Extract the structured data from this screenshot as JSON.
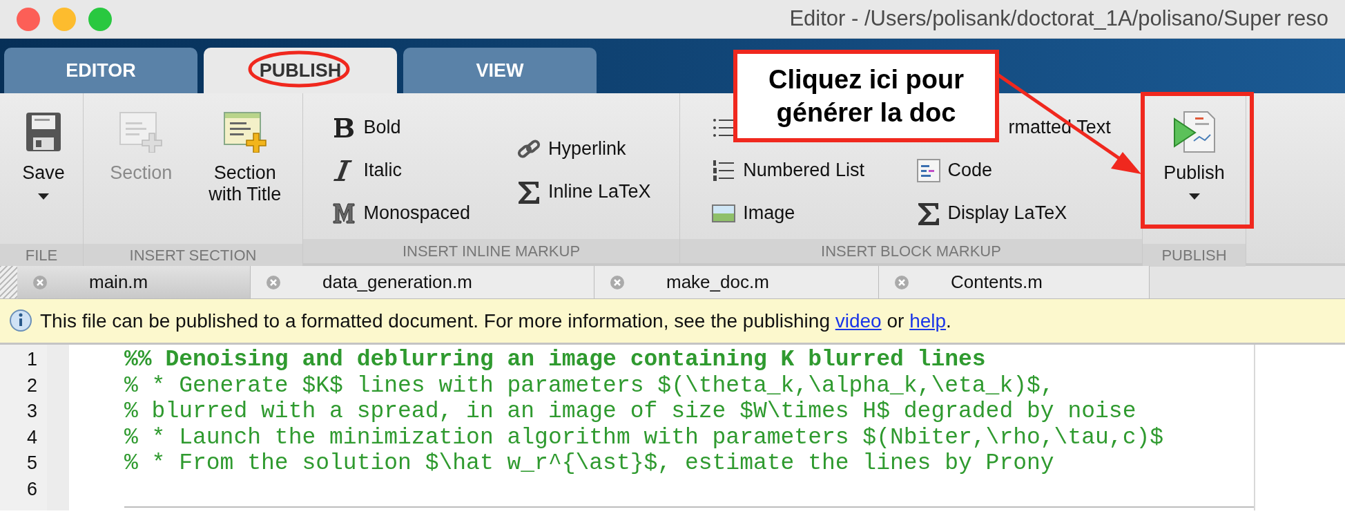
{
  "window": {
    "title": "Editor - /Users/polisank/doctorat_1A/polisano/Super reso"
  },
  "tabs": [
    {
      "label": "EDITOR",
      "selected": false
    },
    {
      "label": "PUBLISH",
      "selected": true
    },
    {
      "label": "VIEW",
      "selected": false
    }
  ],
  "ribbon": {
    "groups": [
      {
        "label": "FILE",
        "columns": [
          [
            {
              "kind": "large",
              "label": "Save",
              "dropdown": true,
              "disabled": false
            }
          ]
        ]
      },
      {
        "label": "INSERT SECTION",
        "columns": [
          [
            {
              "kind": "large",
              "label": "Section",
              "dropdown": false,
              "disabled": true
            }
          ],
          [
            {
              "kind": "large",
              "label": "Section with Title",
              "dropdown": false,
              "disabled": false
            }
          ]
        ]
      },
      {
        "label": "INSERT INLINE MARKUP",
        "columns": [
          [
            {
              "kind": "small",
              "label": "Bold"
            },
            {
              "kind": "small",
              "label": "Italic"
            },
            {
              "kind": "small",
              "label": "Monospaced"
            }
          ],
          [
            {
              "kind": "small",
              "label": "Hyperlink"
            },
            {
              "kind": "small",
              "label": "Inline LaTeX"
            }
          ]
        ]
      },
      {
        "label": "INSERT BLOCK MARKUP",
        "columns": [
          [
            {
              "kind": "small"
            },
            {
              "kind": "small",
              "label": "Numbered List"
            },
            {
              "kind": "small",
              "label": "Image"
            }
          ],
          [
            {
              "kind": "small",
              "label": "rmatted Text"
            },
            {
              "kind": "small",
              "label": "Code"
            },
            {
              "kind": "small",
              "label": "Display LaTeX"
            }
          ]
        ]
      },
      {
        "label": "PUBLISH",
        "columns": [
          [
            {
              "kind": "large",
              "label": "Publish",
              "dropdown": true,
              "disabled": false
            }
          ]
        ]
      }
    ]
  },
  "file_tabs": [
    {
      "label": "main.m",
      "selected": true
    },
    {
      "label": "data_generation.m",
      "selected": false
    },
    {
      "label": "make_doc.m",
      "selected": false
    },
    {
      "label": "Contents.m",
      "selected": false
    }
  ],
  "info_bar": {
    "segments": [
      {
        "kind": "text",
        "text": "This file can be published to a formatted document. For more information, see the publishing"
      },
      {
        "kind": "link",
        "text": "video"
      },
      {
        "kind": "text",
        "text": "or"
      },
      {
        "kind": "link",
        "text": "help"
      },
      {
        "kind": "text",
        "text": "."
      }
    ]
  },
  "code": {
    "lines": [
      {
        "number": "1",
        "kind": "section",
        "text": "%% Denoising and deblurring an image containing K blurred lines"
      },
      {
        "number": "2",
        "kind": "comment",
        "text": "% * Generate $K$ lines with parameters $(\\theta_k,\\alpha_k,\\eta_k)$,"
      },
      {
        "number": "3",
        "kind": "comment",
        "text": "% blurred with a spread, in an image of size $W\\times H$ degraded by noise"
      },
      {
        "number": "4",
        "kind": "comment",
        "text": "% * Launch the minimization algorithm with parameters $(Nbiter,\\rho,\\tau,c)$"
      },
      {
        "number": "5",
        "kind": "comment",
        "text": "% * From the solution $\\hat w_r^{\\ast}$, estimate the lines by Prony"
      },
      {
        "number": "6"
      }
    ]
  },
  "annotation": {
    "callout": [
      "Cliquez ici pour",
      "générer la doc"
    ]
  }
}
